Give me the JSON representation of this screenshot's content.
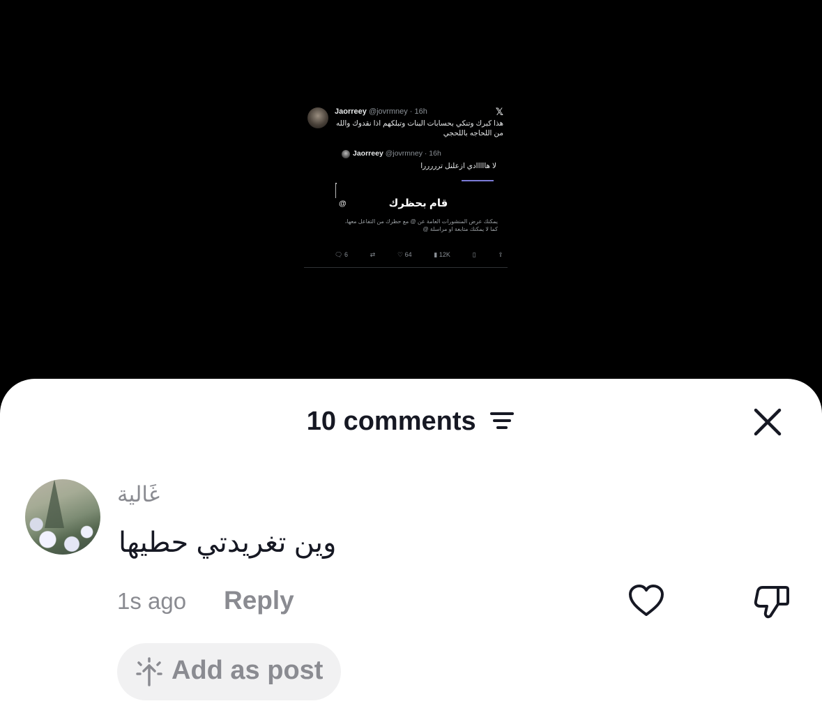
{
  "tweet": {
    "author_name": "Jaorreey",
    "author_handle": "@jovrmney · 16h",
    "body": "هذا كبرك وتنكي بحسابات البنات وتبلكهم اذا نقدوك والله من اللحاجه باللحجي",
    "platform_icon": "x-logo-icon",
    "x_glyph": "𝕏",
    "quoted": {
      "author_name": "Jaorreey",
      "author_handle": "@jovrmney · 16h",
      "body": "لا هااااادي ازعلنل ترررررا",
      "blocked_title": "قام بحظرك",
      "blocked_at": "@",
      "blocked_desc": "يمكنك عرض المنشورات العامة عن @ مع حظرك من التفاعل معها، كما لا يمكنك متابعة او مراسلة @"
    },
    "actions": {
      "replies": "6",
      "retweets": "",
      "likes": "64",
      "views": "12K"
    }
  },
  "comments_sheet": {
    "title": "10 comments",
    "sort_icon": "filter-lines-icon",
    "close_icon": "close-x-icon",
    "comment": {
      "username": "غَالية",
      "text": "وين تغريدتي حطيها",
      "time": "1s ago",
      "reply_label": "Reply",
      "like_icon": "heart-outline-icon",
      "dislike_icon": "thumbs-down-icon"
    },
    "add_post": {
      "label": "Add as post",
      "icon": "sparkle-arrow-icon"
    }
  }
}
